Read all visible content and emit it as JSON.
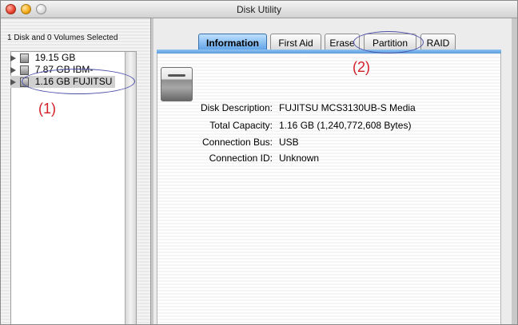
{
  "window": {
    "title": "Disk Utility",
    "controls": [
      "close-button",
      "minimize-button",
      "zoom-button"
    ]
  },
  "left_pane": {
    "status": "1 Disk and 0 Volumes Selected",
    "disks": [
      {
        "label": "19.15 GB",
        "selected": false,
        "icon": "drive-icon"
      },
      {
        "label": "7.87 GB IBM-",
        "selected": false,
        "icon": "drive-icon"
      },
      {
        "label": "1.16 GB FUJITSU",
        "selected": true,
        "icon": "drive-icon"
      }
    ],
    "annotation": "(1)"
  },
  "tabs": [
    {
      "label": "Information",
      "active": true
    },
    {
      "label": "First Aid",
      "active": false
    },
    {
      "label": "Erase",
      "active": false
    },
    {
      "label": "Partition",
      "active": false
    },
    {
      "label": "RAID",
      "active": false
    }
  ],
  "tabs_annotation": "(2)",
  "disk_info": {
    "icon": "hard-disk-icon",
    "rows": [
      {
        "label": "Disk Description:",
        "value": "FUJITSU MCS3130UB-S Media"
      },
      {
        "label": "Total Capacity:",
        "value": "1.16 GB (1,240,772,608 Bytes)"
      },
      {
        "label": "Connection Bus:",
        "value": "USB"
      },
      {
        "label": "Connection ID:",
        "value": "Unknown"
      }
    ]
  },
  "colors": {
    "annotation_text": "#d3202a",
    "annotation_outline": "#4b4fa8",
    "active_tab": "#5ea2e6"
  }
}
